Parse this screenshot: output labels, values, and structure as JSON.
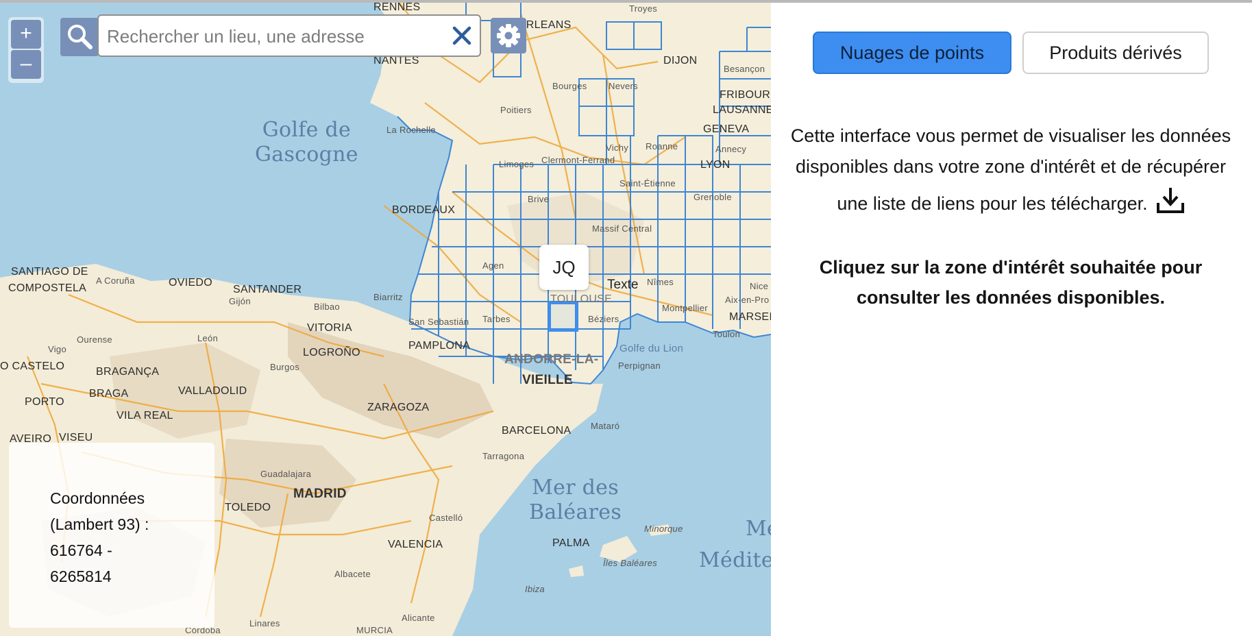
{
  "map": {
    "zoom_in_label": "+",
    "zoom_out_label": "–",
    "search_placeholder": "Rechercher un lieu, une adresse",
    "selected_tile_label": "JQ",
    "annotation_text": "Texte",
    "coordinates": {
      "line1": "Coordonnées",
      "line2": "(Lambert 93) :",
      "line3": "616764 -",
      "line4": "6265814"
    },
    "labels": {
      "rennes": "RENNES",
      "troyes": "Troyes",
      "orleans": "ORLEANS",
      "nantes": "NANTES",
      "dijon": "DIJON",
      "bourges": "Bourges",
      "nevers": "Nevers",
      "poitiers": "Poitiers",
      "besancon": "Besançon",
      "fribourg": "FRIBOURG",
      "lausanne": "LAUSANNE",
      "geneva": "GENEVA",
      "la_rochelle": "La Rochelle",
      "golfe_gascogne_1": "Golfe de",
      "golfe_gascogne_2": "Gascogne",
      "limoges": "Limoges",
      "clermont": "Clermont-Ferrand",
      "vichy": "Vichy",
      "roanne": "Roanne",
      "lyon": "LYON",
      "annecy": "Annecy",
      "saint_etienne": "Saint-Étienne",
      "brive": "Brive",
      "grenoble": "Grenoble",
      "bordeaux": "BORDEAUX",
      "massif_central": "Massif Central",
      "agen": "Agen",
      "nimes": "Nîmes",
      "nice": "Nice",
      "biarritz": "Biarritz",
      "toulouse": "TOULOUSE",
      "montpellier": "Montpellier",
      "aix": "Aix-en-Pro",
      "marseille": "MARSEI",
      "toulon": "Toulon",
      "san_sebastian": "San Sebastián",
      "tarbes": "Tarbes",
      "beziers": "Béziers",
      "golfe_lion": "Golfe du Lion",
      "perpignan": "Perpignan",
      "andorre": "ANDORRE-LA-",
      "vieille": "VIEILLE",
      "santiago_1": "SANTIAGO DE",
      "santiago_2": "COMPOSTELA",
      "coruna": "A Coruña",
      "oviedo": "OVIEDO",
      "santander": "SANTANDER",
      "gijon": "Gijón",
      "bilbao": "Bilbao",
      "vitoria": "VITORIA",
      "pamplona": "PAMPLONA",
      "leon": "León",
      "logrono": "LOGROÑO",
      "ourense": "Ourense",
      "vigo": "Vigo",
      "castelo": "O CASTELO",
      "braganca": "BRAGANÇA",
      "burgos": "Burgos",
      "porto": "PORTO",
      "braga": "BRAGA",
      "valladolid": "VALLADOLID",
      "vila_real": "VILA REAL",
      "zaragoza": "ZARAGOZA",
      "barcelona": "BARCELONA",
      "mataro": "Mataró",
      "aveiro": "AVEIRO",
      "viseu": "VISEU",
      "tarragona": "Tarragona",
      "guadalajara": "Guadalajara",
      "madrid": "MADRID",
      "mer_baleares_1": "Mer des",
      "mer_baleares_2": "Baléares",
      "toledo": "TOLEDO",
      "castello": "Castelló",
      "minorque": "Minorque",
      "valencia": "VALENCIA",
      "palma": "PALMA",
      "med_1": "Me",
      "med_2": "Méditer",
      "iles_baleares": "Îles Baléares",
      "albacete": "Albacete",
      "ibiza": "Ibiza",
      "alicante": "Alicante",
      "linares": "Linares",
      "cordoba": "Córdoba",
      "murcia": "MURCIA"
    }
  },
  "panel": {
    "tab_active": "Nuages de points",
    "tab_inactive": "Produits dérivés",
    "intro_line1": "Cette interface vous permet de visualiser les données",
    "intro_line2": "disponibles dans votre zone d'intérêt et de récupérer",
    "intro_line3": "une liste de liens pour les télécharger.",
    "instruction_line1": "Cliquez sur la zone d'intérêt souhaitée pour",
    "instruction_line2": "consulter les données disponibles."
  },
  "colors": {
    "sea": "#a9cfe4",
    "land": "#f5efdf",
    "grid": "#3f86d2",
    "active_tab": "#3d8ef0",
    "control": "#7890b8"
  }
}
